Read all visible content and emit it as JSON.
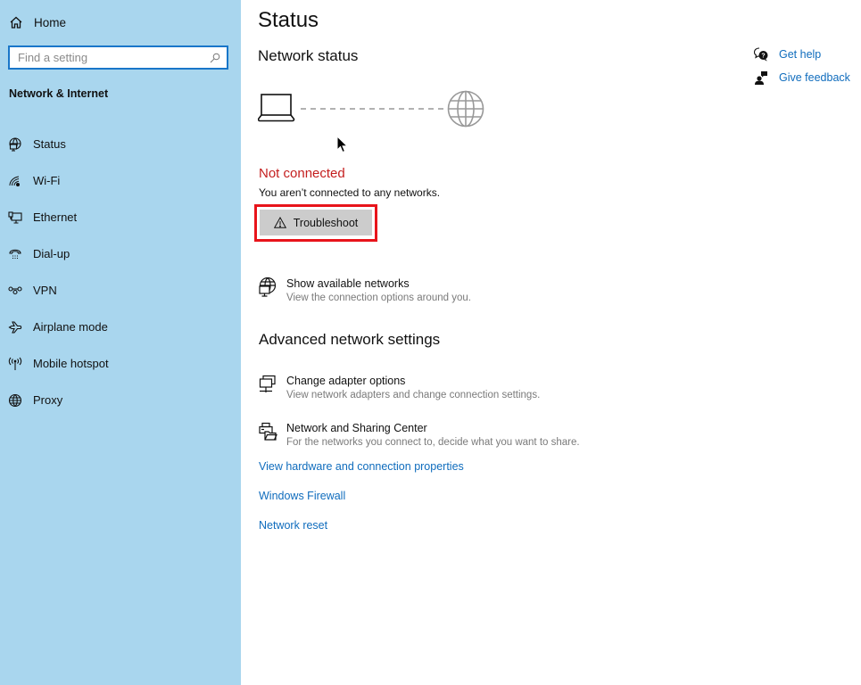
{
  "sidebar": {
    "home_label": "Home",
    "search": {
      "placeholder": "Find a setting",
      "value": ""
    },
    "section_title": "Network & Internet",
    "items": [
      {
        "label": "Status",
        "icon": "status-globe-monitor-icon"
      },
      {
        "label": "Wi-Fi",
        "icon": "wifi-icon"
      },
      {
        "label": "Ethernet",
        "icon": "ethernet-icon"
      },
      {
        "label": "Dial-up",
        "icon": "dialup-phone-icon"
      },
      {
        "label": "VPN",
        "icon": "vpn-icon"
      },
      {
        "label": "Airplane mode",
        "icon": "airplane-icon"
      },
      {
        "label": "Mobile hotspot",
        "icon": "hotspot-icon"
      },
      {
        "label": "Proxy",
        "icon": "globe-icon"
      }
    ]
  },
  "main": {
    "title": "Status",
    "network_status_heading": "Network status",
    "status_text": "Not connected",
    "status_desc": "You aren’t connected to any networks.",
    "troubleshoot_label": "Troubleshoot",
    "show_networks": {
      "title": "Show available networks",
      "desc": "View the connection options around you."
    },
    "advanced_heading": "Advanced network settings",
    "adapter_options": {
      "title": "Change adapter options",
      "desc": "View network adapters and change connection settings."
    },
    "sharing_center": {
      "title": "Network and Sharing Center",
      "desc": "For the networks you connect to, decide what you want to share."
    },
    "links": [
      "View hardware and connection properties",
      "Windows Firewall",
      "Network reset"
    ]
  },
  "help": {
    "get_help": "Get help",
    "give_feedback": "Give feedback"
  },
  "colors": {
    "sidebar_bg": "#a9d6ee",
    "accent_link": "#0f6cbd",
    "error_red": "#c41e1e",
    "highlight_red": "#e8141b"
  }
}
